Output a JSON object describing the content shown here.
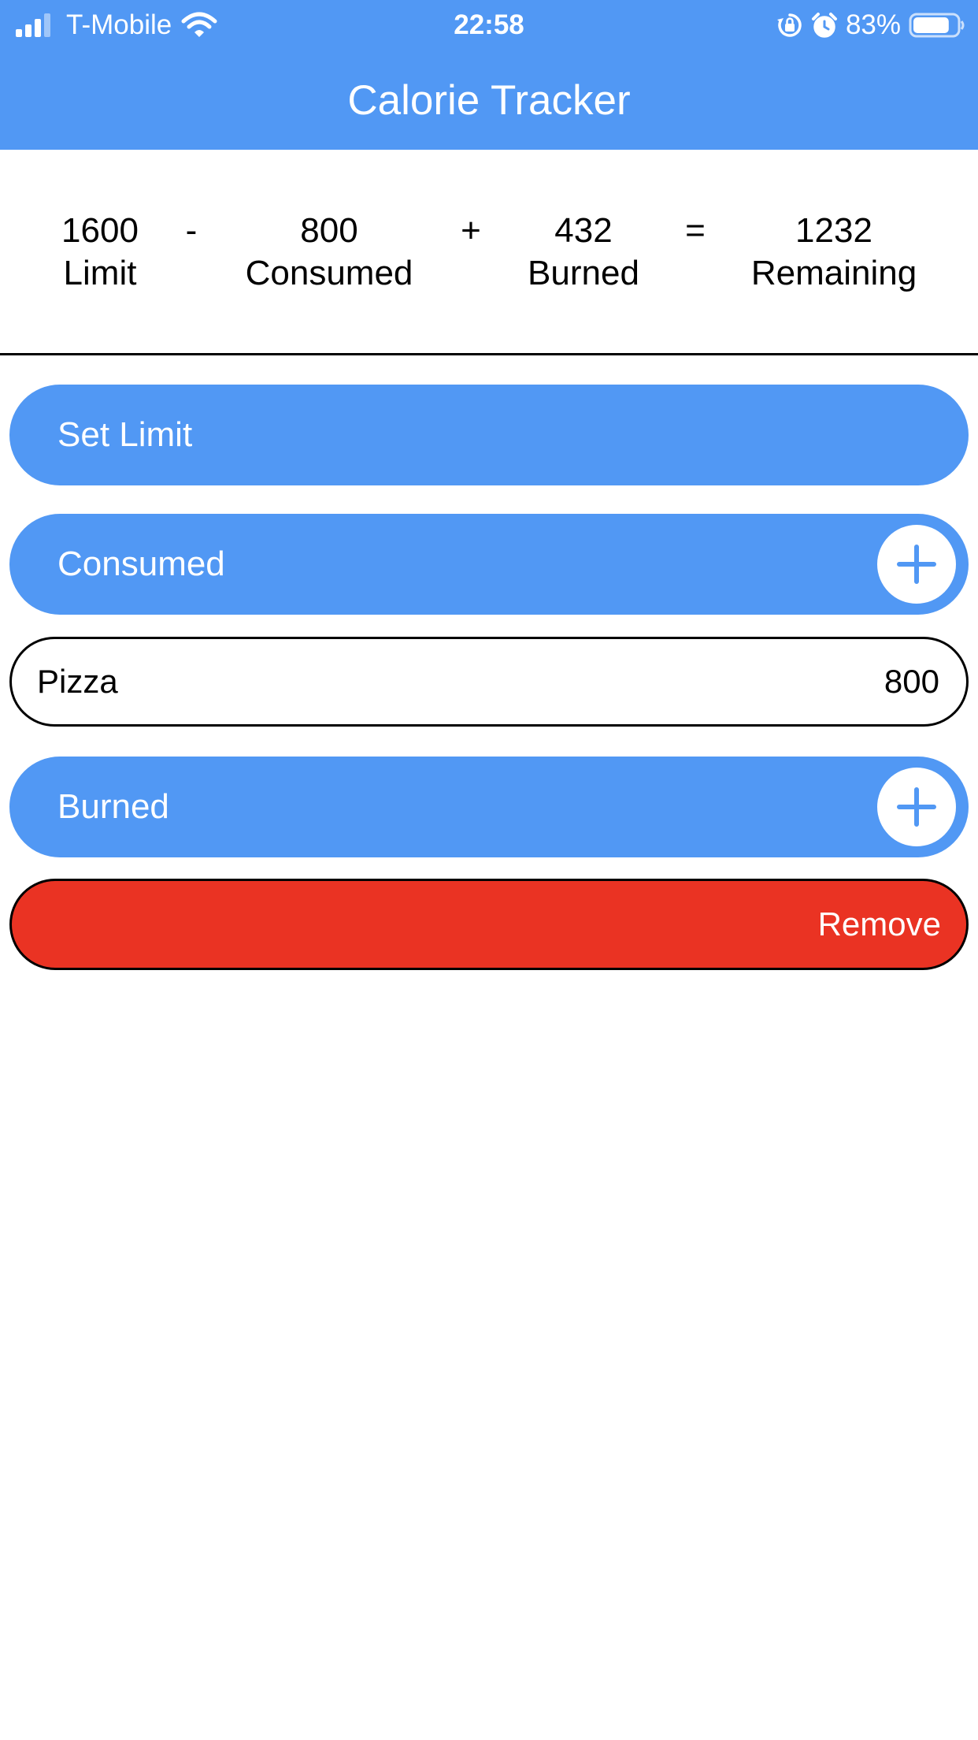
{
  "status_bar": {
    "carrier": "T-Mobile",
    "time": "22:58",
    "battery_percent": "83%",
    "battery_level": 0.83
  },
  "header": {
    "title": "Calorie Tracker"
  },
  "summary": {
    "limit_value": "1600",
    "limit_label": "Limit",
    "minus_sign": "-",
    "consumed_value": "800",
    "consumed_label": "Consumed",
    "plus_sign": "+",
    "burned_value": "432",
    "burned_label": "Burned",
    "equals_sign": "=",
    "remaining_value": "1232",
    "remaining_label": "Remaining"
  },
  "sections": {
    "set_limit_label": "Set Limit",
    "consumed_label": "Consumed",
    "burned_label": "Burned"
  },
  "consumed_items": [
    {
      "name": "Pizza",
      "calories": "800"
    }
  ],
  "remove_label": "Remove",
  "colors": {
    "primary": "#5198F4",
    "danger": "#EA3323",
    "background": "#FFFFFF"
  }
}
